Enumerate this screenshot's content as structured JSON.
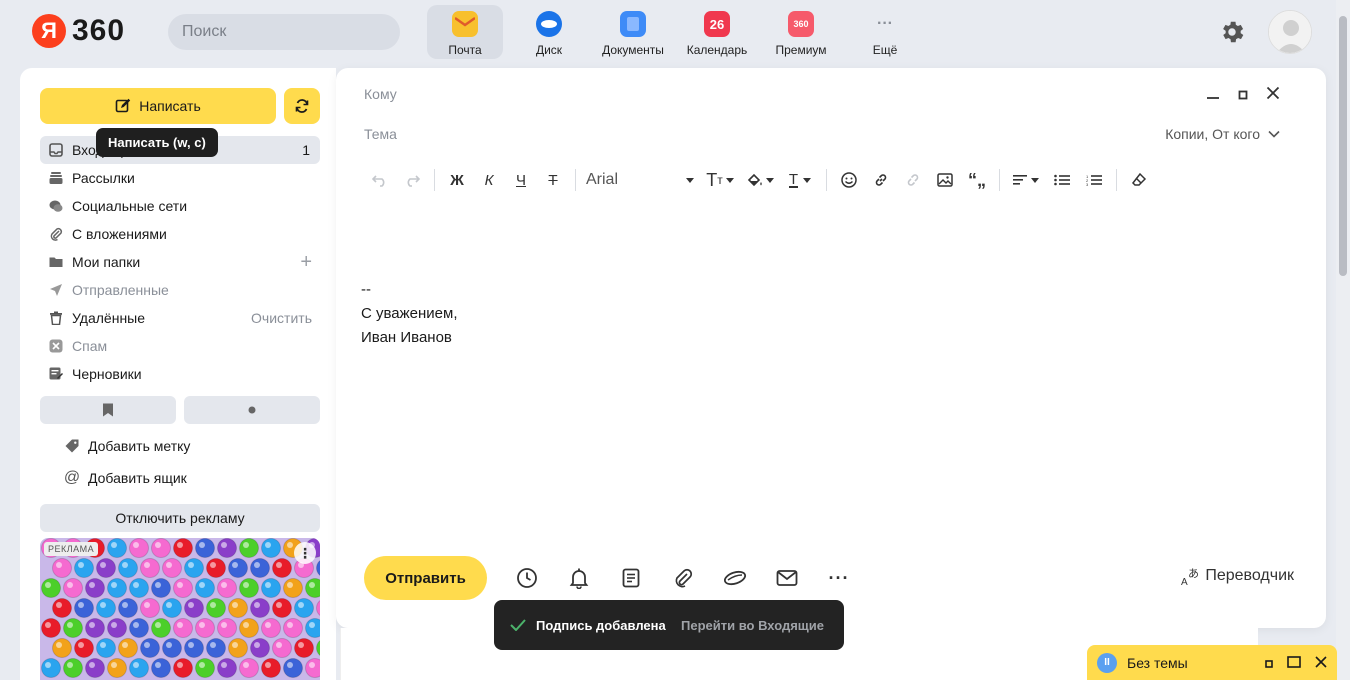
{
  "header": {
    "logo_letter": "Я",
    "logo_text": "360",
    "search_placeholder": "Поиск",
    "services": [
      {
        "label": "Почта",
        "icon": "mail-service-icon",
        "color": "#f8c02d"
      },
      {
        "label": "Диск",
        "icon": "disk-service-icon",
        "color": "#1a73e8"
      },
      {
        "label": "Документы",
        "icon": "docs-service-icon",
        "color": "#3e8bf7"
      },
      {
        "label": "Календарь",
        "icon": "calendar-service-icon",
        "color": "#f0384e",
        "badge": "26"
      },
      {
        "label": "Премиум",
        "icon": "premium-service-icon",
        "color": "#f65a6b",
        "badge": "360"
      },
      {
        "label": "Ещё",
        "icon": "more-service-icon",
        "color": "#8a8f98"
      }
    ]
  },
  "sidebar": {
    "compose_label": "Написать",
    "tooltip": "Написать (w, c)",
    "folders": [
      {
        "label": "Входящие",
        "icon": "inbox-icon",
        "count": "1"
      },
      {
        "label": "Рассылки",
        "icon": "newsletters-icon"
      },
      {
        "label": "Социальные сети",
        "icon": "social-icon"
      },
      {
        "label": "С вложениями",
        "icon": "attachment-icon"
      },
      {
        "label": "Мои папки",
        "icon": "folder-icon",
        "action": "+"
      },
      {
        "label": "Отправленные",
        "icon": "sent-icon"
      },
      {
        "label": "Удалённые",
        "icon": "trash-icon",
        "action": "Очистить"
      },
      {
        "label": "Спам",
        "icon": "spam-icon"
      },
      {
        "label": "Черновики",
        "icon": "drafts-icon"
      }
    ],
    "add_label": "Добавить метку",
    "add_mailbox": "Добавить ящик",
    "ads_off": "Отключить рекламу",
    "ad_badge": "РЕКЛАМА"
  },
  "compose": {
    "to_label": "Кому",
    "subject_label": "Тема",
    "cc_link": "Копии, От кого",
    "font": "Arial",
    "toolbar": {
      "bold": "Ж",
      "italic": "К",
      "underline": "Ч",
      "strike": "Т"
    },
    "signature": [
      "--",
      "С уважением,",
      "Иван Иванов"
    ],
    "send_label": "Отправить",
    "translator_label": "Переводчик"
  },
  "toast": {
    "message": "Подпись добавлена",
    "link": "Перейти во Входящие"
  },
  "draft_bar": {
    "title": "Без темы"
  },
  "colors": {
    "accent": "#ffdb4d",
    "logo_red": "#fc3f1d"
  }
}
